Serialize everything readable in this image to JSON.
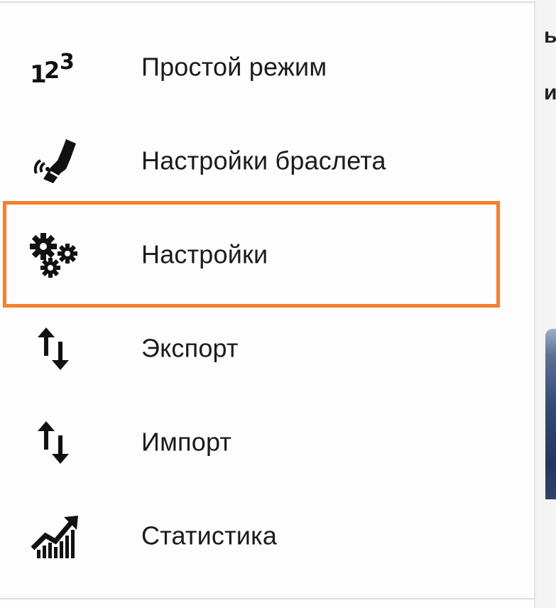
{
  "background_app": {
    "fragments": [
      "ы",
      "ил"
    ]
  },
  "drawer": {
    "items": [
      {
        "label": "Простой режим",
        "icon": "numbers-123-icon"
      },
      {
        "label": "Настройки браслета",
        "icon": "wristband-icon"
      },
      {
        "label": "Настройки",
        "icon": "gears-icon",
        "highlighted": true
      },
      {
        "label": "Экспорт",
        "icon": "swap-vertical-icon"
      },
      {
        "label": "Импорт",
        "icon": "swap-vertical-icon"
      },
      {
        "label": "Статистика",
        "icon": "trending-chart-icon"
      }
    ],
    "highlight_color": "#f57f2c"
  }
}
